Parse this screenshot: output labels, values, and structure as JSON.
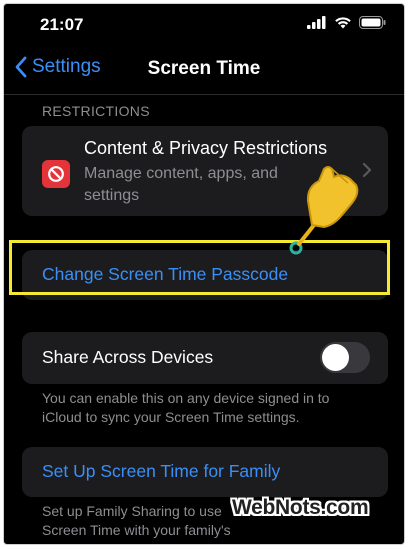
{
  "status_bar": {
    "time": "21:07"
  },
  "nav": {
    "back_label": "Settings",
    "title": "Screen Time"
  },
  "restrictions_section": {
    "header": "RESTRICTIONS",
    "item_title": "Content & Privacy Restrictions",
    "item_subtitle": "Manage content, apps, and settings",
    "icon": "restriction-icon"
  },
  "passcode": {
    "label": "Change Screen Time Passcode",
    "highlight_color": "#f5ea32"
  },
  "share": {
    "label": "Share Across Devices",
    "toggle_on": false,
    "note": "You can enable this on any device signed in to iCloud to sync your Screen Time settings."
  },
  "family": {
    "label": "Set Up Screen Time for Family",
    "note": "Set up Family Sharing to use Screen Time with your family's devices."
  },
  "watermark": "WebNots.com",
  "colors": {
    "accent": "#3a8ff7",
    "background": "#000000",
    "card": "#1c1c1e",
    "restriction_red": "#e5333a"
  }
}
